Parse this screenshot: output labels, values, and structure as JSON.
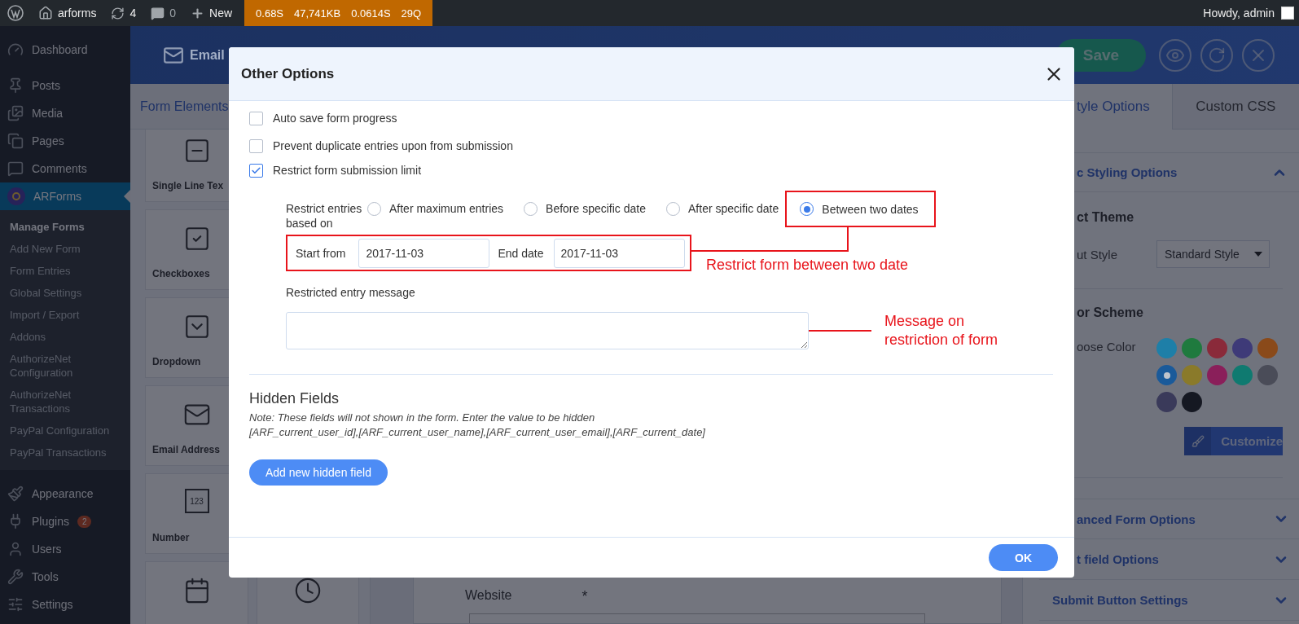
{
  "admin_bar": {
    "site_name": "arforms",
    "updates_count": "4",
    "comments_count": "0",
    "new_label": "New",
    "metrics": [
      "0.68S",
      "47,741KB",
      "0.0614S",
      "29Q"
    ],
    "greeting": "Howdy, admin"
  },
  "sidebar": {
    "items": [
      {
        "label": "Dashboard",
        "selected": false
      },
      {
        "label": "Posts",
        "selected": false
      },
      {
        "label": "Media",
        "selected": false
      },
      {
        "label": "Pages",
        "selected": false
      },
      {
        "label": "Comments",
        "selected": false
      },
      {
        "label": "ARForms",
        "selected": true,
        "submenu": [
          {
            "label": "Manage Forms",
            "selected": true
          },
          {
            "label": "Add New Form",
            "selected": false
          },
          {
            "label": "Form Entries",
            "selected": false
          },
          {
            "label": "Global Settings",
            "selected": false
          },
          {
            "label": "Import / Export",
            "selected": false
          },
          {
            "label": "Addons",
            "selected": false
          },
          {
            "label": "AuthorizeNet Configuration",
            "selected": false
          },
          {
            "label": "AuthorizeNet Transactions",
            "selected": false
          },
          {
            "label": "PayPal Configuration",
            "selected": false
          },
          {
            "label": "PayPal Transactions",
            "selected": false
          }
        ]
      },
      {
        "label": "Appearance",
        "selected": false
      },
      {
        "label": "Plugins",
        "selected": false,
        "badge": "2"
      },
      {
        "label": "Users",
        "selected": false
      },
      {
        "label": "Tools",
        "selected": false
      },
      {
        "label": "Settings",
        "selected": false
      }
    ]
  },
  "builder": {
    "header_title": "Email",
    "save_label": "Save",
    "elements_tab": "Form Elements",
    "elements": [
      {
        "label": "Single Line Tex"
      },
      {
        "label": "Checkboxes"
      },
      {
        "label": "Dropdown"
      },
      {
        "label": "Email Address"
      },
      {
        "label": "Number",
        "icon_text": "123"
      }
    ],
    "canvas_field": {
      "label": "Website",
      "required_mark": "*"
    }
  },
  "right_panel": {
    "tabs": [
      {
        "label": "tyle Options",
        "selected": true
      },
      {
        "label": "Custom CSS",
        "selected": false
      }
    ],
    "section": {
      "title": "c Styling Options",
      "expanded": true,
      "theme_heading": "ct Theme",
      "input_style_label": "ut Style",
      "input_style_value": "Standard Style",
      "color_heading": "or Scheme",
      "choose_color_label": "oose Color",
      "swatches": [
        {
          "color": "#1e7fa8",
          "selected": false
        },
        {
          "color": "#1f7a3e",
          "selected": false
        },
        {
          "color": "#8a2a3a",
          "selected": false
        },
        {
          "color": "#3e3a78",
          "selected": false
        },
        {
          "color": "#8a4a1a",
          "selected": false
        },
        {
          "color": "#1a5a9a",
          "selected": true
        },
        {
          "color": "#8a7a2a",
          "selected": false
        },
        {
          "color": "#8a1f5a",
          "selected": false
        },
        {
          "color": "#0f7a70",
          "selected": false
        },
        {
          "color": "#4a4c58",
          "selected": false
        },
        {
          "color": "#3a3a5a",
          "selected": false
        },
        {
          "color": "#151822",
          "selected": false
        }
      ],
      "customize_label": "Customize"
    },
    "accordions": [
      {
        "label": "anced Form Options",
        "expanded": false
      },
      {
        "label": "t field Options",
        "expanded": false
      },
      {
        "label": "Submit Button Settings",
        "expanded": false
      }
    ]
  },
  "modal": {
    "title": "Other Options",
    "options": [
      {
        "label": "Auto save form progress",
        "checked": false
      },
      {
        "label": "Prevent duplicate entries upon from submission",
        "checked": false
      },
      {
        "label": "Restrict form submission limit",
        "checked": true
      }
    ],
    "restrict_label": "Restrict entries based on",
    "radios": [
      {
        "label": "After maximum entries",
        "selected": false
      },
      {
        "label": "Before specific date",
        "selected": false
      },
      {
        "label": "After specific date",
        "selected": false
      },
      {
        "label": "Between two dates",
        "selected": true
      }
    ],
    "start_label": "Start from",
    "start_value": "2017-11-03",
    "end_label": "End date",
    "end_value": "2017-11-03",
    "message_label": "Restricted entry message",
    "hidden_title": "Hidden Fields",
    "note_lines": [
      "Note: These fields will not shown in the form. Enter the value to be hidden",
      "[ARF_current_user_id],[ARF_current_user_name],[ARF_current_user_email],[ARF_current_date]"
    ],
    "add_button": "Add new hidden field",
    "ok_button": "OK"
  },
  "annotations": [
    {
      "text": "Restrict form between two date"
    },
    {
      "text": "Message on restriction of form"
    }
  ]
}
